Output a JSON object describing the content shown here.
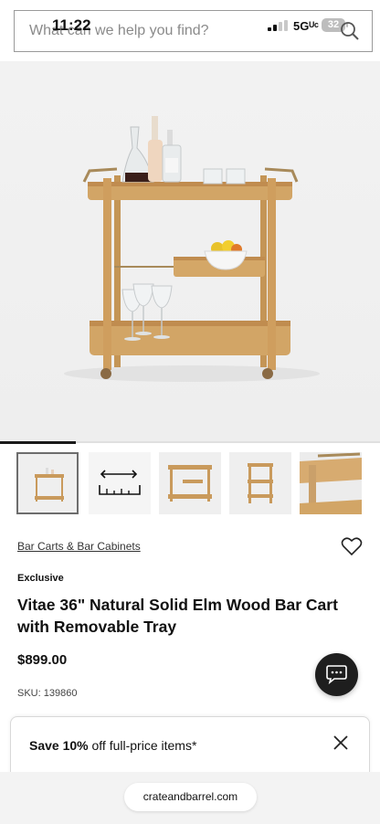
{
  "status": {
    "time": "11:22",
    "network": "5Gᵁᶜ",
    "battery": "32"
  },
  "search": {
    "placeholder": "What can we help you find?",
    "icon": "search-icon"
  },
  "gallery": {
    "main_image": "bar-cart-photo",
    "progress": 0.2,
    "thumbnails": [
      {
        "name": "thumb-cart-styled",
        "active": true
      },
      {
        "name": "thumb-dimensions-icon",
        "active": false
      },
      {
        "name": "thumb-cart-front",
        "active": false
      },
      {
        "name": "thumb-cart-side",
        "active": false
      },
      {
        "name": "thumb-cart-detail",
        "active": false
      }
    ]
  },
  "product": {
    "breadcrumb": "Bar Carts & Bar Cabinets",
    "badge": "Exclusive",
    "title": "Vitae 36\" Natural Solid Elm Wood Bar Cart with Removable Tray",
    "price": "$899.00",
    "sku": "SKU: 139860"
  },
  "promo": {
    "bold": "Save 10%",
    "rest": " off full-price items*"
  },
  "browser": {
    "url": "crateandbarrel.com"
  },
  "colors": {
    "wood": "#c99a5c",
    "brass": "#a88a5a",
    "dark": "#1e1e1e"
  }
}
